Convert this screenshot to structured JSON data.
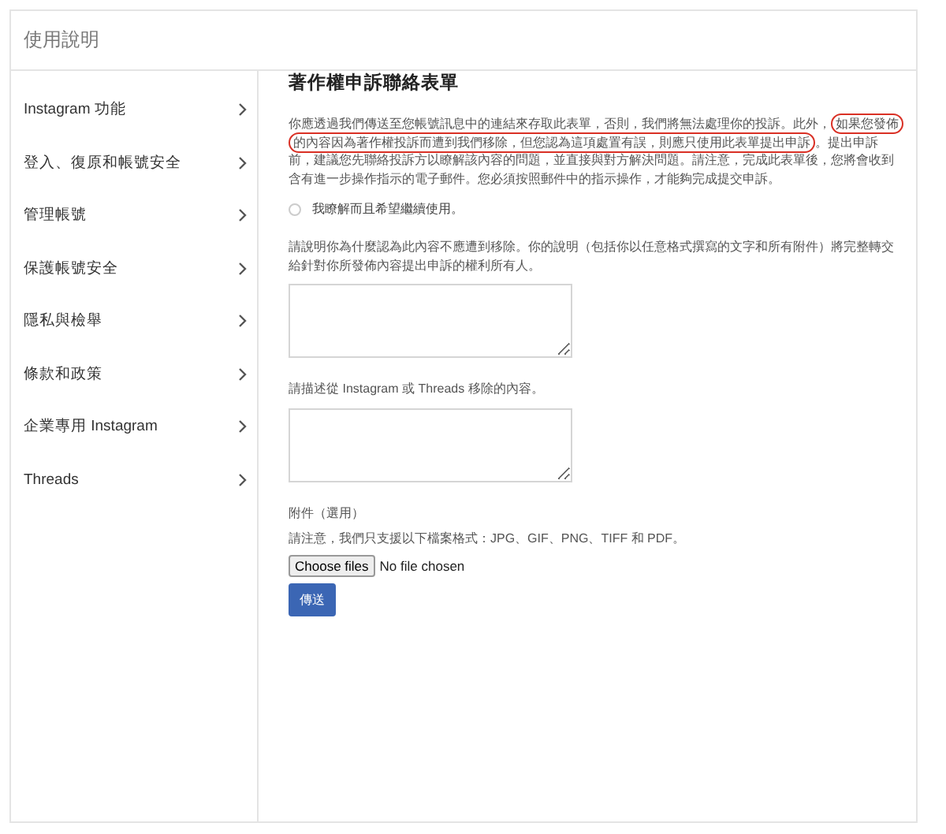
{
  "header": {
    "title": "使用說明"
  },
  "sidebar": {
    "items": [
      {
        "label": "Instagram 功能"
      },
      {
        "label": "登入、復原和帳號安全"
      },
      {
        "label": "管理帳號"
      },
      {
        "label": "保護帳號安全"
      },
      {
        "label": "隱私與檢舉"
      },
      {
        "label": "條款和政策"
      },
      {
        "label": "企業專用 Instagram"
      },
      {
        "label": "Threads"
      }
    ]
  },
  "form": {
    "title": "著作權申訴聯絡表單",
    "intro": {
      "before": "你應透過我們傳送至您帳號訊息中的連結來存取此表單，否則，我們將無法處理你的投訴。此外，",
      "highlighted": "如果您發佈的內容因為著作權投訴而遭到我們移除，但您認為這項處置有誤，則應只使用此表單提出申訴",
      "after": "。提出申訴前，建議您先聯絡投訴方以瞭解該內容的問題，並直接與對方解決問題。請注意，完成此表單後，您將會收到含有進一步操作指示的電子郵件。您必須按照郵件中的指示操作，才能夠完成提交申訴。"
    },
    "radio": {
      "label": "我瞭解而且希望繼續使用。",
      "selected": false
    },
    "fields": [
      {
        "label": "請說明你為什麼認為此內容不應遭到移除。你的說明（包括你以任意格式撰寫的文字和所有附件）將完整轉交給針對你所發佈內容提出申訴的權利所有人。"
      },
      {
        "label": "請描述從 Instagram 或 Threads 移除的內容。"
      }
    ],
    "attachment": {
      "label": "附件（選用）",
      "note": "請注意，我們只支援以下檔案格式：JPG、GIF、PNG、TIFF 和 PDF。",
      "button": "Choose files",
      "status": "No file chosen"
    },
    "submit": "傳送"
  }
}
